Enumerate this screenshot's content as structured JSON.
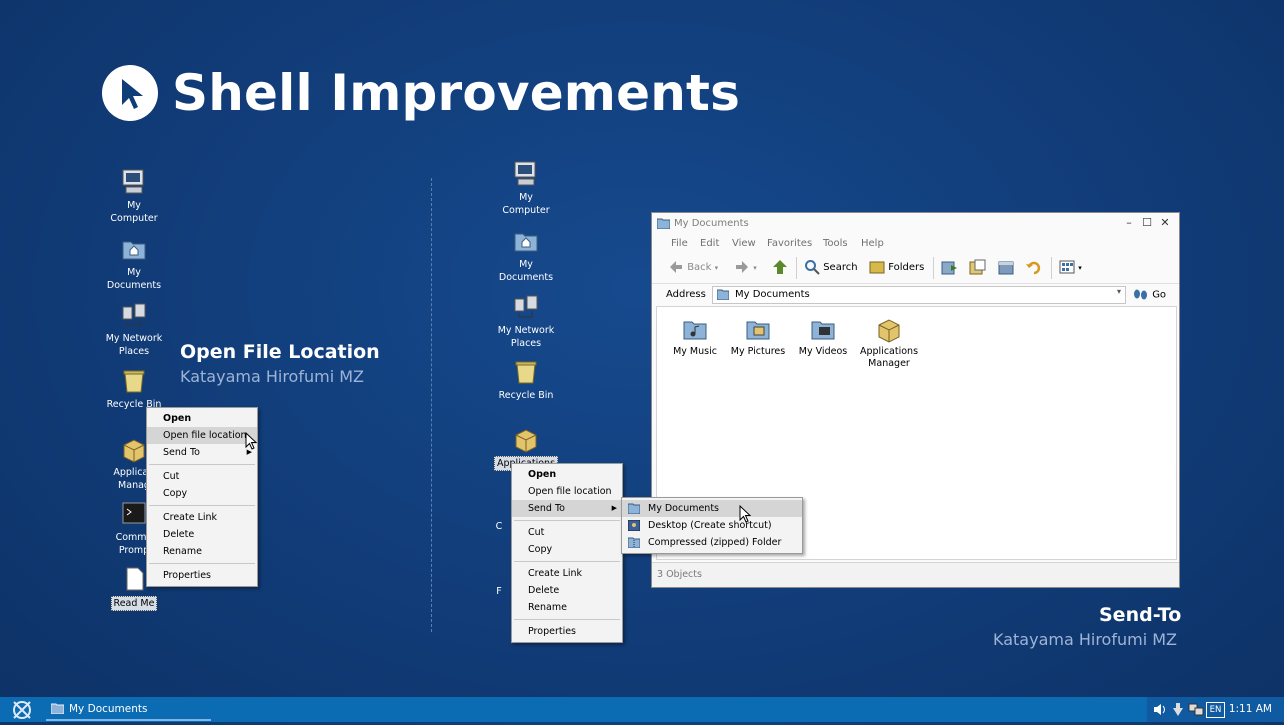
{
  "slide": {
    "title": "Shell Improvements",
    "left_caption": {
      "title": "Open File Location",
      "author": "Katayama Hirofumi MZ"
    },
    "right_caption": {
      "title": "Send-To",
      "author": "Katayama Hirofumi MZ"
    }
  },
  "left_desktop": {
    "icons": [
      {
        "name": "desktop-icon-my-computer",
        "label1": "My",
        "label2": "Computer"
      },
      {
        "name": "desktop-icon-my-documents",
        "label1": "My",
        "label2": "Documents"
      },
      {
        "name": "desktop-icon-my-network-places",
        "label1": "My Network",
        "label2": "Places"
      },
      {
        "name": "desktop-icon-recycle-bin",
        "label1": "Recycle Bin",
        "label2": ""
      },
      {
        "name": "desktop-icon-applications-manager",
        "label1": "Applicati",
        "label2": "Manag"
      },
      {
        "name": "desktop-icon-command-prompt",
        "label1": "Comma",
        "label2": "Promp"
      },
      {
        "name": "desktop-icon-read-me",
        "label1": "Read Me",
        "label2": ""
      }
    ],
    "context_menu": [
      "Open",
      "Open file location",
      "Send To",
      "Cut",
      "Copy",
      "Create Link",
      "Delete",
      "Rename",
      "Properties"
    ]
  },
  "right_desktop": {
    "icons": [
      {
        "name": "desktop-icon-my-computer",
        "label1": "My",
        "label2": "Computer"
      },
      {
        "name": "desktop-icon-my-documents",
        "label1": "My",
        "label2": "Documents"
      },
      {
        "name": "desktop-icon-my-network-places",
        "label1": "My Network",
        "label2": "Places"
      },
      {
        "name": "desktop-icon-recycle-bin",
        "label1": "Recycle Bin",
        "label2": ""
      },
      {
        "name": "desktop-icon-applications-manager",
        "label1": "Applications",
        "label2": "M"
      },
      {
        "name": "desktop-icon-partial-1",
        "label1": "C",
        "label2": ""
      },
      {
        "name": "desktop-icon-partial-2",
        "label1": "F",
        "label2": ""
      }
    ],
    "context_menu": [
      "Open",
      "Open file location",
      "Send To",
      "Cut",
      "Copy",
      "Create Link",
      "Delete",
      "Rename",
      "Properties"
    ],
    "send_to_menu": [
      "My Documents",
      "Desktop (Create shortcut)",
      "Compressed (zipped) Folder"
    ]
  },
  "explorer": {
    "title": "My Documents",
    "menus": [
      "File",
      "Edit",
      "View",
      "Favorites",
      "Tools",
      "Help"
    ],
    "toolbar": {
      "back": "Back",
      "search": "Search",
      "folders": "Folders"
    },
    "address_label": "Address",
    "address_value": "My Documents",
    "go_label": "Go",
    "items": [
      "My Music",
      "My Pictures",
      "My Videos",
      "Applications",
      "Manager"
    ],
    "status": "3 Objects"
  },
  "taskbar": {
    "task_label": "My Documents",
    "language": "EN",
    "clock": "1:11 AM"
  }
}
